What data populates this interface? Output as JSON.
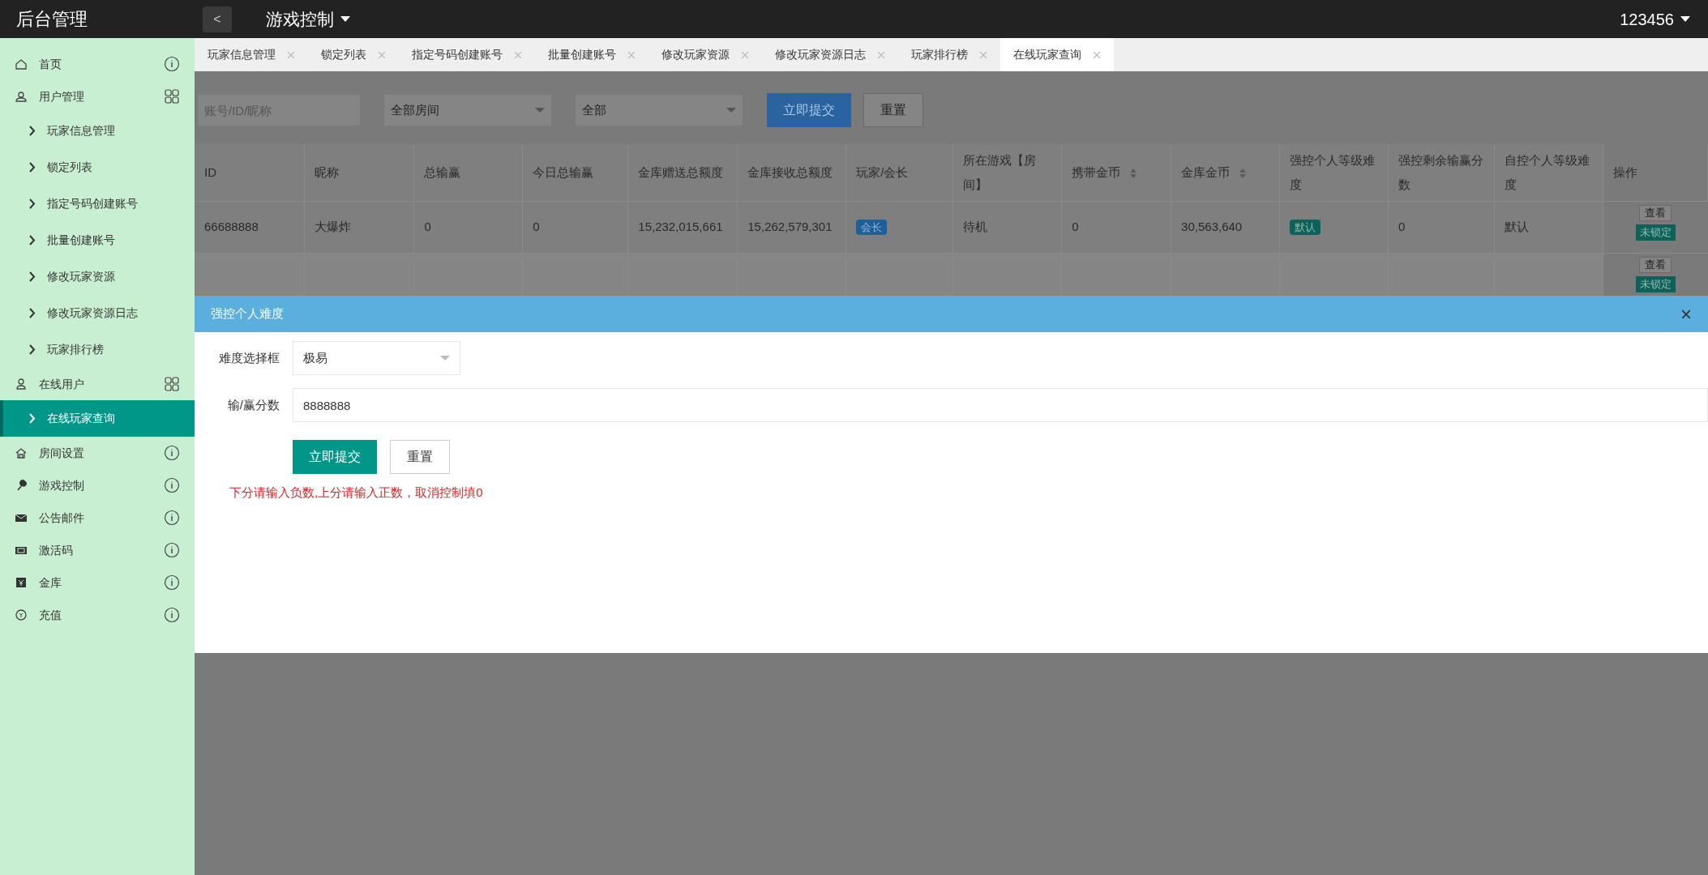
{
  "header": {
    "brand": "后台管理",
    "back": "<",
    "section": "游戏控制",
    "user": "123456"
  },
  "sidebar": [
    {
      "label": "首页",
      "selected": false
    },
    {
      "label": "用户管理",
      "selected": false,
      "children": [
        {
          "label": "玩家信息管理",
          "selected": false
        },
        {
          "label": "锁定列表",
          "selected": false
        },
        {
          "label": "指定号码创建账号",
          "selected": false
        },
        {
          "label": "批量创建账号",
          "selected": false
        },
        {
          "label": "修改玩家资源",
          "selected": false
        },
        {
          "label": "修改玩家资源日志",
          "selected": false
        },
        {
          "label": "玩家排行榜",
          "selected": false
        }
      ]
    },
    {
      "label": "在线用户",
      "selected": false,
      "children": [
        {
          "label": "在线玩家查询",
          "selected": true
        }
      ]
    },
    {
      "label": "房间设置",
      "selected": false
    },
    {
      "label": "游戏控制",
      "selected": false
    },
    {
      "label": "公告邮件",
      "selected": false
    },
    {
      "label": "激活码",
      "selected": false
    },
    {
      "label": "金库",
      "selected": false
    },
    {
      "label": "充值",
      "selected": false
    }
  ],
  "tabs": [
    {
      "label": "玩家信息管理",
      "selected": false
    },
    {
      "label": "锁定列表",
      "selected": false
    },
    {
      "label": "指定号码创建账号",
      "selected": false
    },
    {
      "label": "批量创建账号",
      "selected": false
    },
    {
      "label": "修改玩家资源",
      "selected": false
    },
    {
      "label": "修改玩家资源日志",
      "selected": false
    },
    {
      "label": "玩家排行榜",
      "selected": false
    },
    {
      "label": "在线玩家查询",
      "selected": true
    }
  ],
  "filters": {
    "search_placeholder": "账号/ID/昵称",
    "room": "全部房间",
    "status": "全部",
    "submit": "立即提交",
    "reset": "重置"
  },
  "table": {
    "columns": [
      {
        "label": "ID",
        "sortable": false
      },
      {
        "label": "昵称",
        "sortable": false
      },
      {
        "label": "总输赢",
        "sortable": false
      },
      {
        "label": "今日总输赢",
        "sortable": false
      },
      {
        "label": "金库赠送总额度",
        "sortable": false
      },
      {
        "label": "金库接收总额度",
        "sortable": false
      },
      {
        "label": "玩家/会长",
        "sortable": false
      },
      {
        "label": "所在游戏【房间】",
        "sortable": false
      },
      {
        "label": "携带金币",
        "sortable": true
      },
      {
        "label": "金库金币",
        "sortable": true
      },
      {
        "label": "强控个人等级难度",
        "sortable": false
      },
      {
        "label": "强控剩余输赢分数",
        "sortable": false
      },
      {
        "label": "自控个人等级难度",
        "sortable": false
      },
      {
        "label": "操作",
        "sortable": false
      }
    ],
    "rows": [
      {
        "cells": [
          "66688888",
          "大爆炸",
          "0",
          "0",
          "15,232,015,661",
          "15,262,579,301",
          "会长",
          "待机",
          "0",
          "30,563,640",
          "默认",
          "0",
          "默认"
        ],
        "actions": [
          "查看",
          "未锁定"
        ]
      },
      {
        "cells": [],
        "actions": [
          "查看",
          "未锁定"
        ]
      }
    ]
  },
  "modal": {
    "title": "强控个人难度",
    "close": "×",
    "fields": [
      {
        "kind": "select",
        "label": "难度选择框",
        "value": "极易"
      },
      {
        "kind": "input",
        "label": "输/赢分数",
        "value": "8888888"
      }
    ],
    "submit": "立即提交",
    "reset": "重置",
    "hint": "下分请输入负数,上分请输入正数，取消控制填0"
  }
}
